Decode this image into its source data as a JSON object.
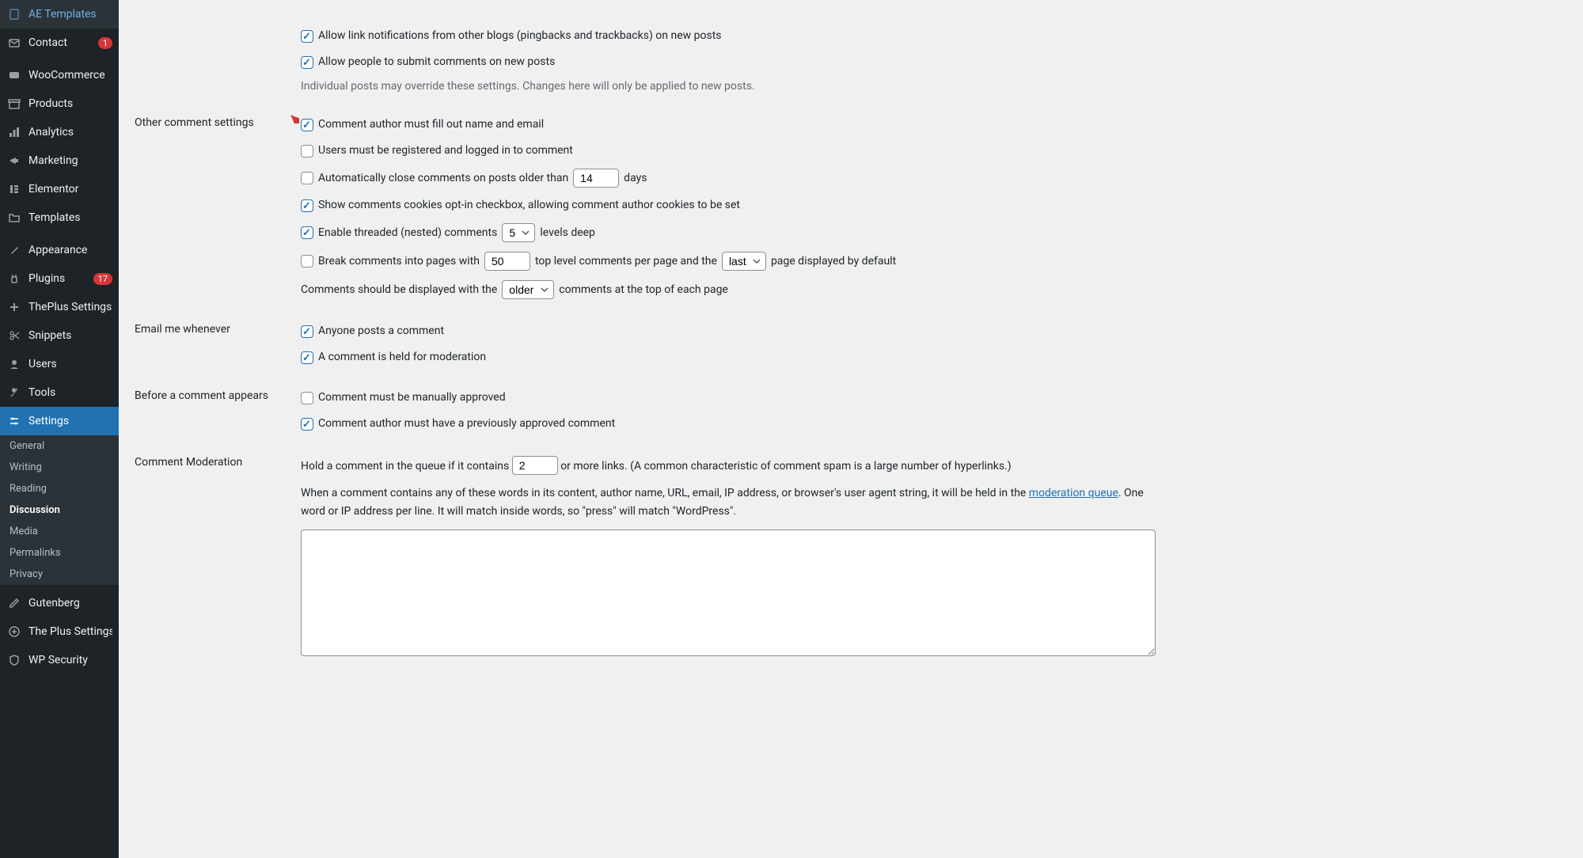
{
  "sidebar": {
    "items": [
      {
        "id": "ae-templates",
        "label": "AE Templates",
        "icon": "file"
      },
      {
        "id": "contact",
        "label": "Contact",
        "icon": "mail",
        "badge": "1"
      },
      {
        "id": "woocommerce",
        "label": "WooCommerce",
        "icon": "woo"
      },
      {
        "id": "products",
        "label": "Products",
        "icon": "archive"
      },
      {
        "id": "analytics",
        "label": "Analytics",
        "icon": "chart"
      },
      {
        "id": "marketing",
        "label": "Marketing",
        "icon": "megaphone"
      },
      {
        "id": "elementor",
        "label": "Elementor",
        "icon": "elementor"
      },
      {
        "id": "templates",
        "label": "Templates",
        "icon": "folder"
      },
      {
        "id": "appearance",
        "label": "Appearance",
        "icon": "brush"
      },
      {
        "id": "plugins",
        "label": "Plugins",
        "icon": "plugin",
        "badge": "17"
      },
      {
        "id": "theplus",
        "label": "ThePlus Settings",
        "icon": "plus"
      },
      {
        "id": "snippets",
        "label": "Snippets",
        "icon": "scissors"
      },
      {
        "id": "users",
        "label": "Users",
        "icon": "user"
      },
      {
        "id": "tools",
        "label": "Tools",
        "icon": "wrench"
      },
      {
        "id": "settings",
        "label": "Settings",
        "icon": "sliders",
        "active": true
      },
      {
        "id": "gutenberg",
        "label": "Gutenberg",
        "icon": "pencil"
      },
      {
        "id": "theplus2",
        "label": "The Plus Settings",
        "icon": "plus2"
      },
      {
        "id": "wpsecurity",
        "label": "WP Security",
        "icon": "shield"
      }
    ],
    "submenu": [
      {
        "id": "general",
        "label": "General"
      },
      {
        "id": "writing",
        "label": "Writing"
      },
      {
        "id": "reading",
        "label": "Reading"
      },
      {
        "id": "discussion",
        "label": "Discussion",
        "current": true
      },
      {
        "id": "media",
        "label": "Media"
      },
      {
        "id": "permalinks",
        "label": "Permalinks"
      },
      {
        "id": "privacy",
        "label": "Privacy"
      }
    ]
  },
  "sections": {
    "default_post": {
      "opt1": "Allow link notifications from other blogs (pingbacks and trackbacks) on new posts",
      "opt2": "Allow people to submit comments on new posts",
      "desc": "Individual posts may override these settings. Changes here will only be applied to new posts."
    },
    "other": {
      "heading": "Other comment settings",
      "opt1": "Comment author must fill out name and email",
      "opt2": "Users must be registered and logged in to comment",
      "opt3_pre": "Automatically close comments on posts older than",
      "opt3_val": "14",
      "opt3_post": "days",
      "opt4": "Show comments cookies opt-in checkbox, allowing comment author cookies to be set",
      "opt5_pre": "Enable threaded (nested) comments",
      "opt5_val": "5",
      "opt5_post": "levels deep",
      "opt6_pre": "Break comments into pages with",
      "opt6_val": "50",
      "opt6_mid": "top level comments per page and the",
      "opt6_sel": "last",
      "opt6_post": "page displayed by default",
      "opt7_pre": "Comments should be displayed with the",
      "opt7_sel": "older",
      "opt7_post": "comments at the top of each page"
    },
    "email": {
      "heading": "Email me whenever",
      "opt1": "Anyone posts a comment",
      "opt2": "A comment is held for moderation"
    },
    "before": {
      "heading": "Before a comment appears",
      "opt1": "Comment must be manually approved",
      "opt2": "Comment author must have a previously approved comment"
    },
    "moderation": {
      "heading": "Comment Moderation",
      "line1_pre": "Hold a comment in the queue if it contains",
      "line1_val": "2",
      "line1_post": "or more links. (A common characteristic of comment spam is a large number of hyperlinks.)",
      "line2_pre": "When a comment contains any of these words in its content, author name, URL, email, IP address, or browser's user agent string, it will be held in the ",
      "line2_link": "moderation queue",
      "line2_post": ". One word or IP address per line. It will match inside words, so \"press\" will match \"WordPress\"."
    }
  }
}
